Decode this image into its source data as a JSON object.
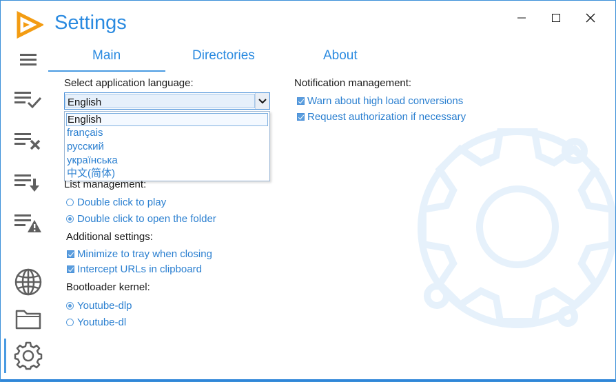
{
  "window": {
    "title": "Settings",
    "minimize_label": "Minimize",
    "maximize_label": "Maximize",
    "close_label": "Close"
  },
  "colors": {
    "accent": "#2a8ae0",
    "logo": "#f39c12",
    "icon_gray": "#5f5f5f",
    "background": "#ffffff"
  },
  "sidebar": {
    "items": [
      {
        "icon": "menu-icon"
      },
      {
        "icon": "list-check-icon"
      },
      {
        "icon": "list-remove-icon"
      },
      {
        "icon": "list-download-icon"
      },
      {
        "icon": "list-warning-icon"
      },
      {
        "icon": "globe-icon"
      },
      {
        "icon": "folder-icon"
      },
      {
        "icon": "gear-icon",
        "active": true
      }
    ]
  },
  "tabs": [
    {
      "label": "Main",
      "active": true
    },
    {
      "label": "Directories"
    },
    {
      "label": "About"
    }
  ],
  "language": {
    "label": "Select application language:",
    "selected": "English",
    "options": [
      "English",
      "français",
      "русский",
      "українська",
      "中文(简体)"
    ]
  },
  "list_management": {
    "label": "List management:",
    "options": [
      {
        "label": "Double click to play",
        "checked": false
      },
      {
        "label": "Double click to open the folder",
        "checked": true
      }
    ]
  },
  "additional": {
    "label": "Additional settings:",
    "options": [
      {
        "label": "Minimize to tray when closing",
        "checked": true
      },
      {
        "label": "Intercept URLs in clipboard",
        "checked": true
      }
    ]
  },
  "bootloader": {
    "label": "Bootloader kernel:",
    "options": [
      {
        "label": "Youtube-dlp",
        "checked": true
      },
      {
        "label": "Youtube-dl",
        "checked": false
      }
    ]
  },
  "notifications": {
    "label": "Notification management:",
    "options": [
      {
        "label": "Warn about high load conversions",
        "checked": true
      },
      {
        "label": "Request authorization if necessary",
        "checked": true
      }
    ]
  }
}
